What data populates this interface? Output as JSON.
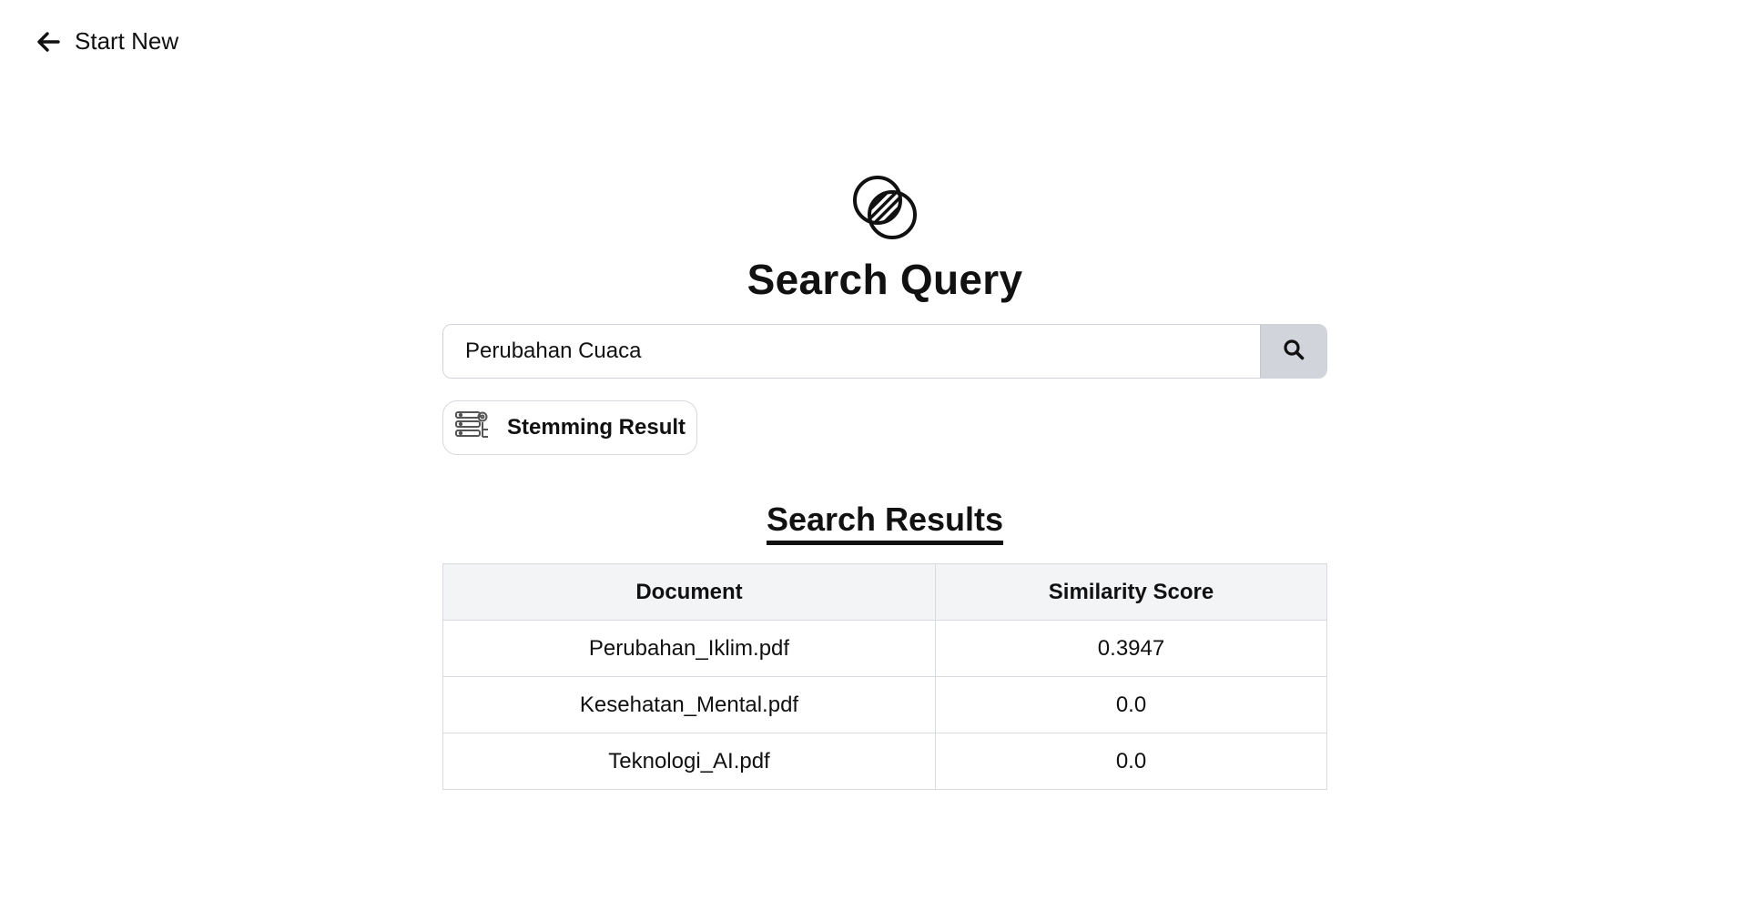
{
  "header": {
    "back_label": "Start New",
    "back_icon": "arrow-left-icon"
  },
  "logo": {
    "icon": "venn-intersection-icon"
  },
  "title": "Search Query",
  "search": {
    "value": "Perubahan Cuaca",
    "placeholder": "",
    "button_icon": "search-icon"
  },
  "stemming": {
    "label": "Stemming Result",
    "icon": "settings-list-icon"
  },
  "results": {
    "title": "Search Results",
    "columns": [
      "Document",
      "Similarity Score"
    ],
    "rows": [
      {
        "document": "Perubahan_Iklim.pdf",
        "score": "0.3947"
      },
      {
        "document": "Kesehatan_Mental.pdf",
        "score": "0.0"
      },
      {
        "document": "Teknologi_AI.pdf",
        "score": "0.0"
      }
    ]
  },
  "colors": {
    "text": "#111111",
    "button_bg": "#d1d5db",
    "border": "#d8dbe0",
    "table_header_bg": "#f3f4f6"
  }
}
